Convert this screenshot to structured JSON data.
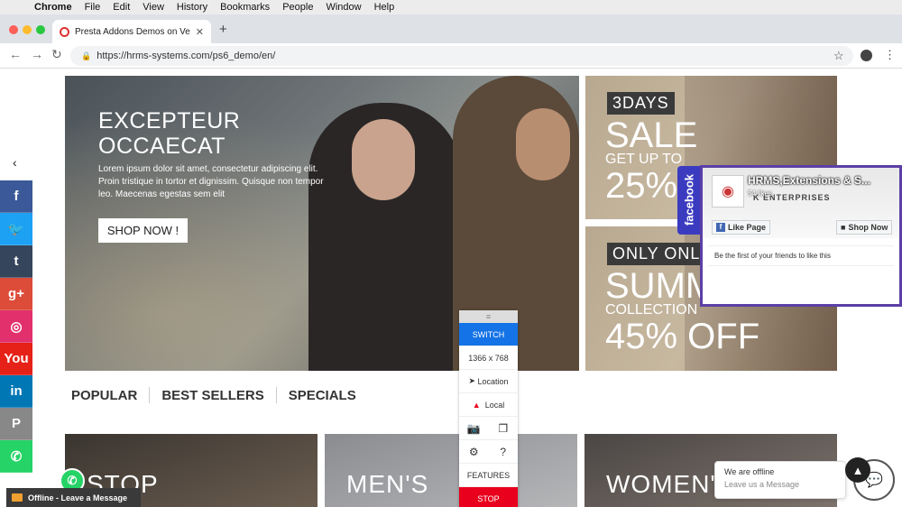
{
  "menubar": {
    "app": "Chrome",
    "items": [
      "File",
      "Edit",
      "View",
      "History",
      "Bookmarks",
      "People",
      "Window",
      "Help"
    ]
  },
  "browser": {
    "tab_title": "Presta Addons Demos on Vers",
    "url": "https://hrms-systems.com/ps6_demo/en/"
  },
  "hero": {
    "heading_line1": "EXCEPTEUR",
    "heading_line2": "OCCAECAT",
    "body": "Lorem ipsum dolor sit amet, consectetur adipiscing elit. Proin tristique in tortor et dignissim. Quisque non tempor leo. Maecenas egestas sem elit",
    "cta": "SHOP NOW !"
  },
  "banner1": {
    "tag": "3DAYS",
    "big": "SALE",
    "mid": "GET UP TO",
    "pct": "25%"
  },
  "banner2": {
    "tag": "ONLY ONLI",
    "big": "SUMM",
    "mid": "COLLECTION",
    "pct": "45% OFF"
  },
  "social": [
    {
      "name": "facebook-icon",
      "glyph": "f",
      "color": "#3b5998"
    },
    {
      "name": "twitter-icon",
      "glyph": "🐦",
      "color": "#1da1f2"
    },
    {
      "name": "tumblr-icon",
      "glyph": "t",
      "color": "#35465c"
    },
    {
      "name": "googleplus-icon",
      "glyph": "g+",
      "color": "#dd4b39"
    },
    {
      "name": "instagram-icon",
      "glyph": "◎",
      "color": "#e1306c"
    },
    {
      "name": "youtube-icon",
      "glyph": "You",
      "color": "#e62117"
    },
    {
      "name": "linkedin-icon",
      "glyph": "in",
      "color": "#0077b5"
    },
    {
      "name": "pinterest-icon",
      "glyph": "P",
      "color": "#888888"
    },
    {
      "name": "whatsapp-icon",
      "glyph": "✆",
      "color": "#25d366"
    }
  ],
  "home_tabs": [
    "POPULAR",
    "BEST SELLERS",
    "SPECIALS"
  ],
  "thumbs": [
    "STOP",
    "MEN'S",
    "WOMEN'"
  ],
  "switcher": {
    "switch": "SWITCH",
    "resolution": "1366 x 768",
    "location": "Location",
    "local": "Local",
    "features": "FEATURES",
    "stop": "STOP"
  },
  "facebook": {
    "tab_label": "facebook",
    "page_name": "HRMS,Extensions & S...",
    "likes": "54 likes",
    "header_text": "K ENTERPRISES",
    "like_button": "Like Page",
    "shop_button": "Shop Now",
    "friends_text": "Be the first of your friends to like this"
  },
  "livechat": {
    "bar_label": "Offline - Leave a Message",
    "offline_title": "We are offline",
    "offline_sub": "Leave us a Message"
  }
}
